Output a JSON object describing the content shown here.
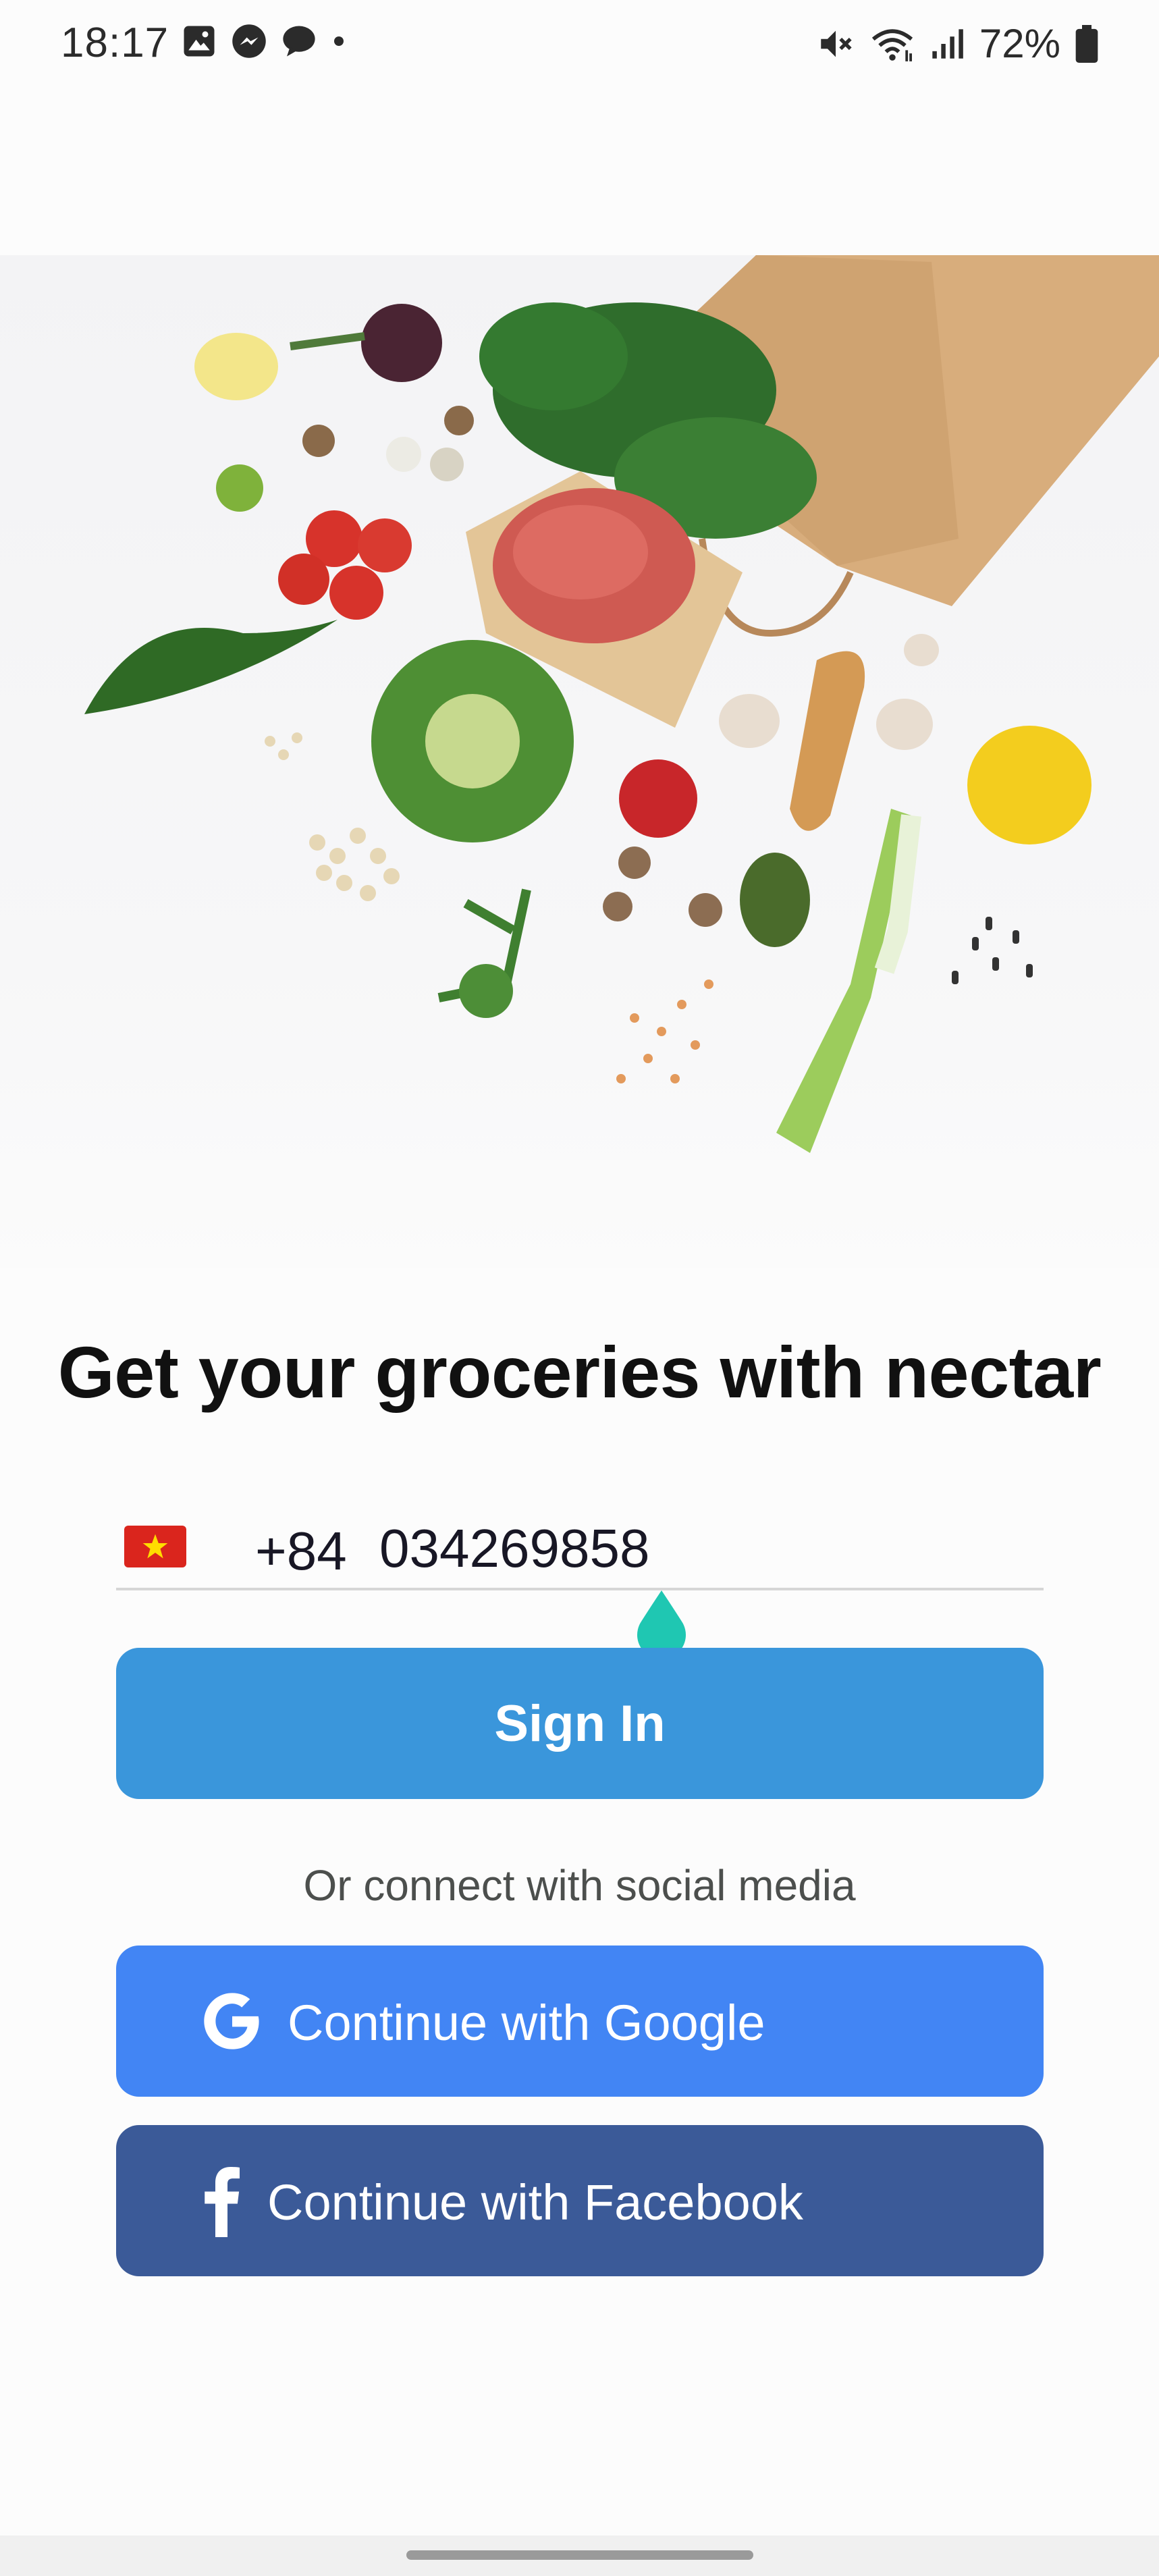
{
  "status_bar": {
    "time": "18:17",
    "battery": "72%",
    "left_icons": [
      "gallery-icon",
      "messenger-icon",
      "chat-bubble-icon",
      "dot-icon"
    ],
    "right_icons": [
      "mute-icon",
      "wifi-icon",
      "signal-icon",
      "battery-icon"
    ]
  },
  "hero": {
    "description_icon": "groceries-illustration"
  },
  "headline": "Get your groceries with nectar",
  "phone_input": {
    "flag": "Vietnam",
    "country_code": "+84",
    "value": "034269858"
  },
  "sign_in_label": "Sign In",
  "social": {
    "divider_text": "Or connect with social media",
    "google_label": "Continue with Google",
    "facebook_label": "Continue with Facebook"
  },
  "colors": {
    "primary": "#3a96db",
    "google": "#4285f4",
    "facebook": "#3b5a98",
    "cursor_handle": "#1fc7b2"
  }
}
